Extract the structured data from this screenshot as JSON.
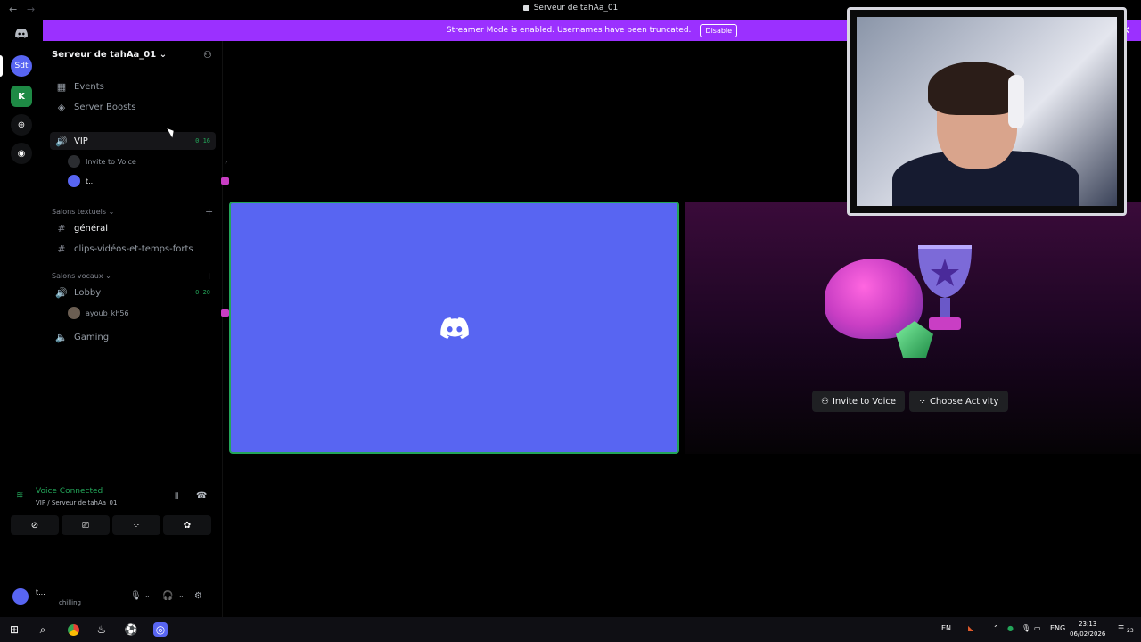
{
  "window": {
    "title": "Serveur de tahAa_01"
  },
  "banner": {
    "text": "Streamer Mode is enabled. Usernames have been truncated.",
    "disable_label": "Disable",
    "color": "#9b30ff"
  },
  "server": {
    "name": "Serveur de tahAa_01"
  },
  "nav": {
    "events": "Events",
    "boosts": "Server Boosts"
  },
  "vip": {
    "name": "VIP",
    "time": "0:16",
    "invite": "Invite to Voice",
    "member": "t..."
  },
  "categories": {
    "text": "Salons textuels",
    "voice": "Salons vocaux"
  },
  "text_channels": [
    "général",
    "clips-vidéos-et-temps-forts"
  ],
  "voice_channels": {
    "lobby": {
      "name": "Lobby",
      "time": "0:20",
      "member": "ayoub_kh56"
    },
    "gaming": {
      "name": "Gaming"
    }
  },
  "voice_panel": {
    "status": "Voice Connected",
    "location": "VIP / Serveur de tahAa_01"
  },
  "user": {
    "name": "t...",
    "status": "chilling"
  },
  "activity": {
    "invite_label": "Invite to Voice",
    "choose_label": "Choose Activity"
  },
  "rail": {
    "server_abbrev": "Sdt"
  },
  "taskbar": {
    "lang": "EN",
    "lang2": "ENG",
    "time": "23:13",
    "date": "06/02/2026",
    "notif": "23"
  },
  "colors": {
    "brand": "#5865f2",
    "green": "#23a559",
    "streamer_purple": "#9b30ff"
  }
}
